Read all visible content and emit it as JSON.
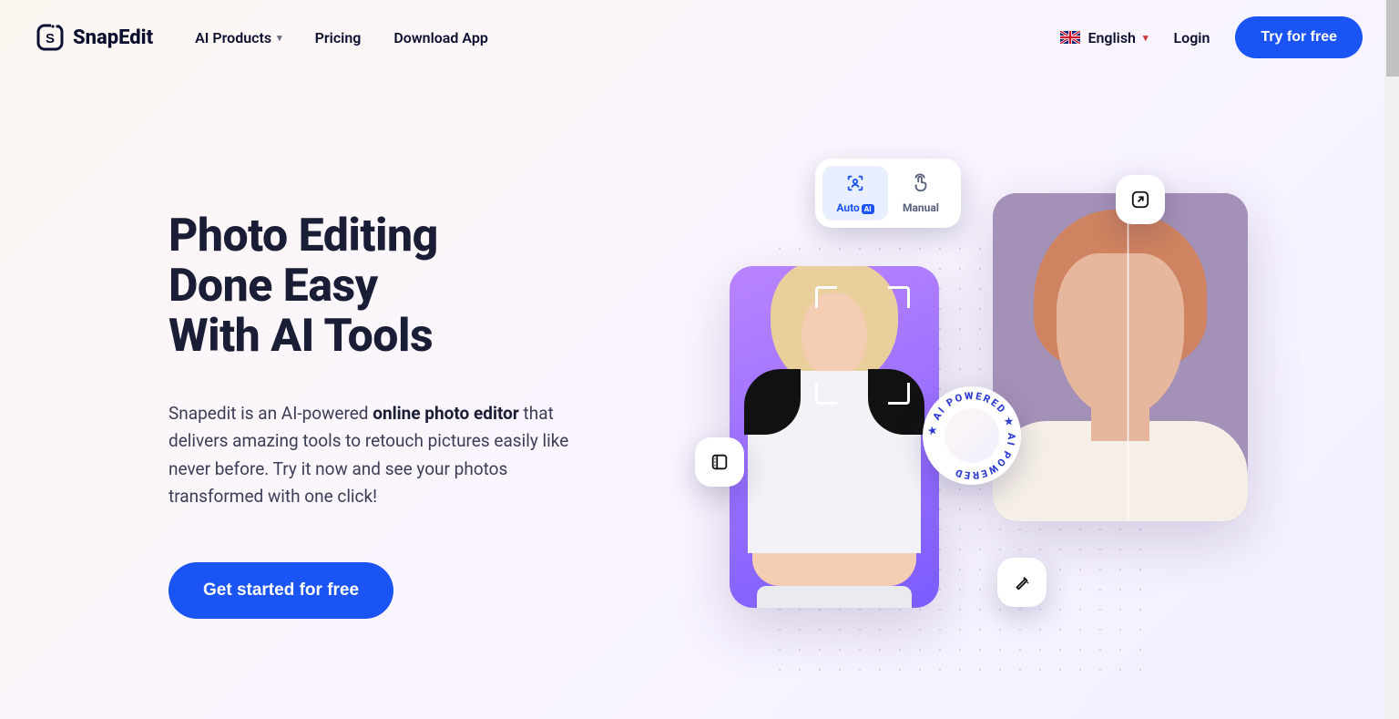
{
  "brand": "SnapEdit",
  "nav": {
    "ai_products": "AI Products",
    "pricing": "Pricing",
    "download": "Download App"
  },
  "lang": {
    "label": "English"
  },
  "auth": {
    "login": "Login",
    "cta": "Try for free"
  },
  "hero": {
    "title_l1": "Photo Editing",
    "title_l2": "Done Easy",
    "title_l3": "With AI Tools",
    "desc_pre": "Snapedit is an AI-powered ",
    "desc_bold": "online photo editor",
    "desc_post": " that delivers amazing tools to retouch pictures easily like never before. Try it now and see your photos transformed with one click!",
    "cta": "Get started for free"
  },
  "modes": {
    "auto": "Auto",
    "ai_tag": "AI",
    "manual": "Manual"
  },
  "ring": {
    "w1": "AI",
    "w2": "POWERED",
    "w3": "AI",
    "w4": "POWERED"
  }
}
